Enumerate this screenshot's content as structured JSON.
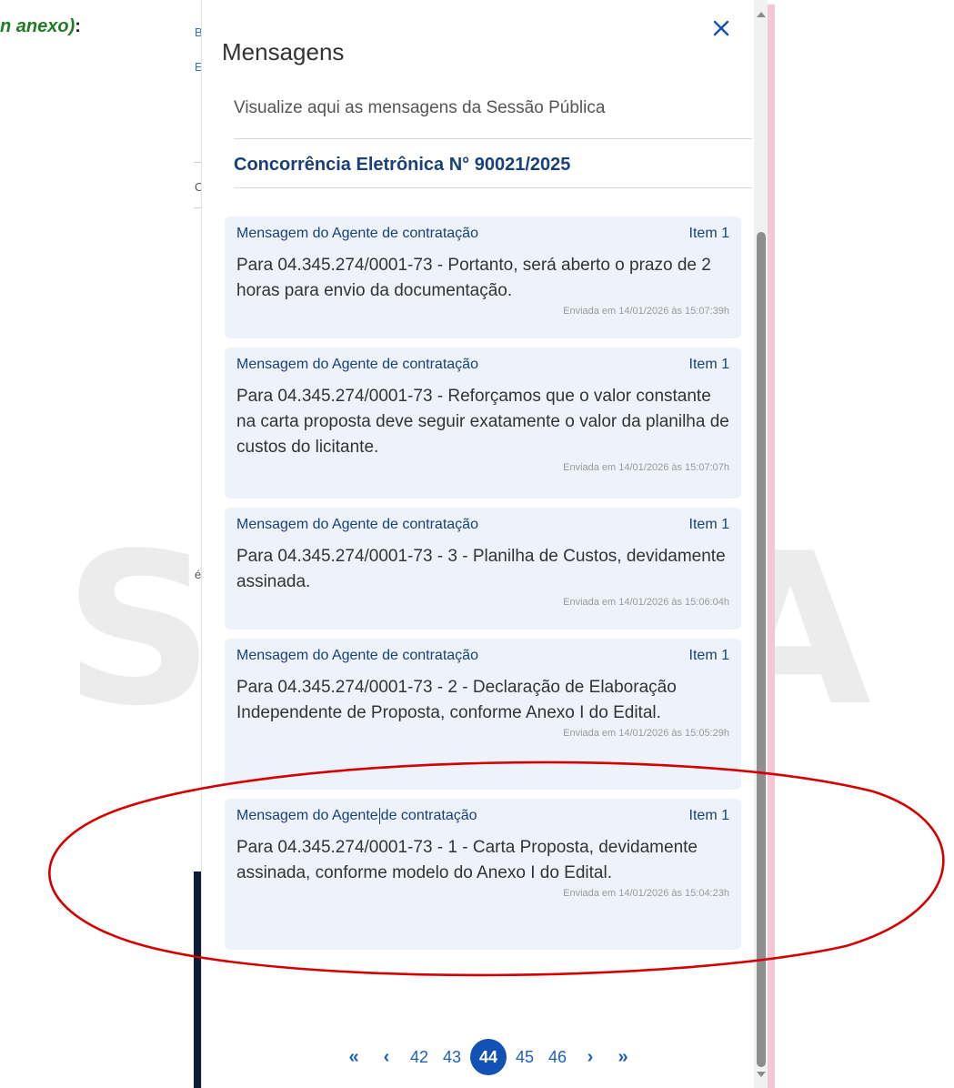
{
  "background": {
    "label_main": "n anexo)",
    "label_colon": ":",
    "fragments": [
      "B",
      "E",
      "C",
      "é"
    ]
  },
  "panel": {
    "title": "Mensagens",
    "subtitle": "Visualize aqui as mensagens da Sessão Pública",
    "process_title": "Concorrência Eletrônica N° 90021/2025",
    "close_icon": "close-icon"
  },
  "messages": [
    {
      "sender": "Mensagem do Agente de contratação",
      "item": "Item 1",
      "text": "Para 04.345.274/0001-73 - Portanto, será aberto o prazo de 2 horas para envio da documentação.",
      "sent": "Enviada em 14/01/2026 às 15:07:39h"
    },
    {
      "sender": "Mensagem do Agente de contratação",
      "item": "Item 1",
      "text": "Para 04.345.274/0001-73 - Reforçamos que o valor constante na carta proposta deve seguir exatamente o valor da planilha de custos do licitante.",
      "sent": "Enviada em 14/01/2026 às 15:07:07h"
    },
    {
      "sender": "Mensagem do Agente de contratação",
      "item": "Item 1",
      "text": "Para 04.345.274/0001-73 - 3 - Planilha de Custos, devidamente assinada.",
      "sent": "Enviada em 14/01/2026 às 15:06:04h"
    },
    {
      "sender": "Mensagem do Agente de contratação",
      "item": "Item 1",
      "text": "Para 04.345.274/0001-73 - 2 - Declaração de Elaboração Independente de Proposta, conforme Anexo I do Edital.",
      "sent": "Enviada em 14/01/2026 às 15:05:29h"
    },
    {
      "sender_part1": "Mensagem do Agente",
      "sender_part2": "de contratação",
      "item": "Item 1",
      "text": "Para 04.345.274/0001-73 - 1 - Carta Proposta, devidamente assinada, conforme modelo do Anexo I do Edital.",
      "sent": "Enviada em 14/01/2026 às 15:04:23h"
    }
  ],
  "pagination": {
    "first": "«",
    "prev": "‹",
    "pages": [
      "42",
      "43",
      "44",
      "45",
      "46"
    ],
    "current": "44",
    "next": "›",
    "last": "»"
  },
  "colors": {
    "accent": "#1351b4",
    "card_bg": "#eef3fb",
    "title_blue": "#1b3f7a",
    "annotation_red": "#d40000",
    "label_green": "#1e7d25"
  }
}
